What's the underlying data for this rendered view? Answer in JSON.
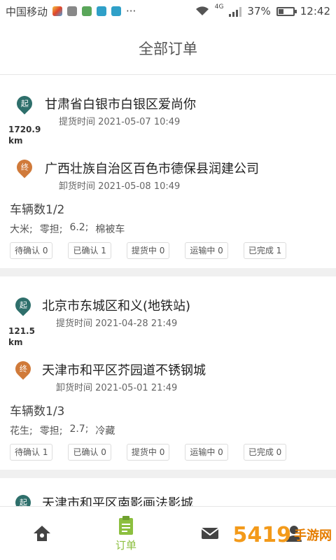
{
  "status_bar": {
    "carrier": "中国移动",
    "network": "4G",
    "battery_percent": "37%",
    "battery_level": 0.37,
    "time": "12:42",
    "more": "···"
  },
  "header": {
    "title": "全部订单"
  },
  "orders": [
    {
      "start_marker": "起",
      "pickup_address": "甘肃省白银市白银区爱尚你",
      "pickup_time": "提货时间 2021-05-07 10:49",
      "distance": "1720.9",
      "distance_unit": "km",
      "end_marker": "终",
      "delivery_address": "广西壮族自治区百色市德保县润建公司",
      "delivery_time": "卸货时间 2021-05-08 10:49",
      "vehicles": "车辆数1/2",
      "goods": [
        "大米;",
        "零担;",
        "6.2;",
        "棉被车"
      ],
      "chips": [
        "待确认 0",
        "已确认 1",
        "提货中 0",
        "运输中 0",
        "已完成 1"
      ]
    },
    {
      "start_marker": "起",
      "pickup_address": "北京市东城区和义(地铁站)",
      "pickup_time": "提货时间 2021-04-28 21:49",
      "distance": "121.5",
      "distance_unit": "km",
      "end_marker": "终",
      "delivery_address": "天津市和平区芥园道不锈钢城",
      "delivery_time": "卸货时间 2021-05-01 21:49",
      "vehicles": "车辆数1/3",
      "goods": [
        "花生;",
        "零担;",
        "2.7;",
        "冷藏"
      ],
      "chips": [
        "待确认 1",
        "已确认 0",
        "提货中 0",
        "运输中 0",
        "已完成 0"
      ]
    },
    {
      "start_marker": "起",
      "pickup_address": "天津市和平区南影画法影城"
    }
  ],
  "bottom_nav": {
    "orders_label": "订单"
  },
  "watermark": {
    "text": "5419",
    "sub": "手游网"
  },
  "colors": {
    "accent": "#8cbf3f",
    "start_pin": "#2e6f6b",
    "end_pin": "#d07a3a"
  }
}
